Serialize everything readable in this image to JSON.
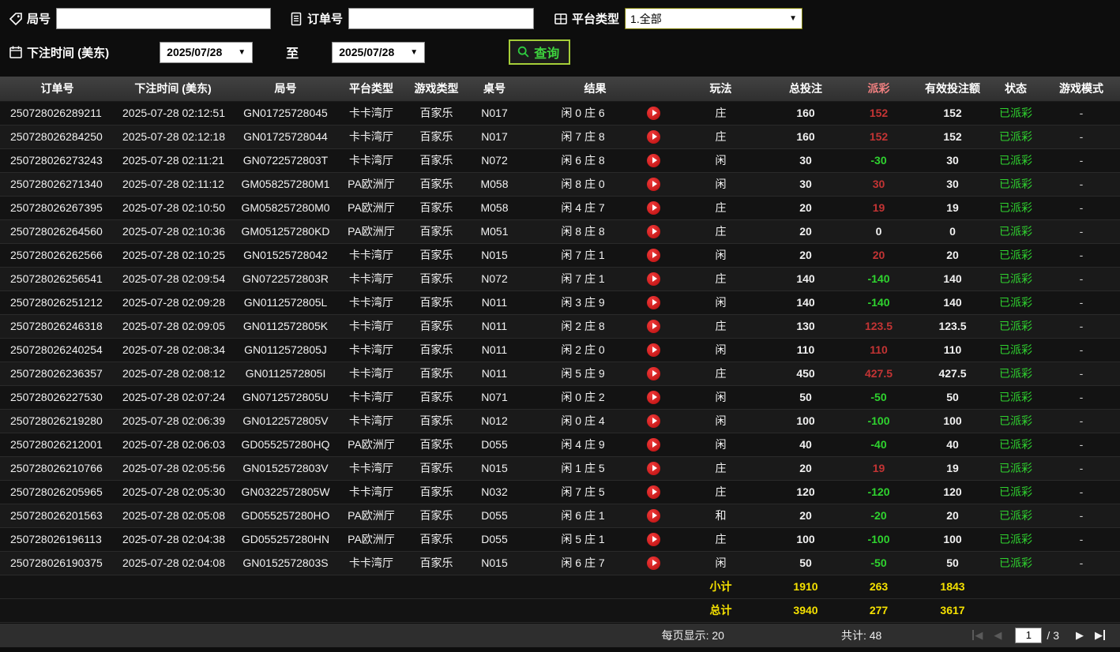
{
  "filters": {
    "round": {
      "label": "局号",
      "value": "",
      "icon": "tag-icon"
    },
    "order": {
      "label": "订单号",
      "value": "",
      "icon": "document-icon"
    },
    "platform": {
      "label": "平台类型",
      "value": "1.全部",
      "icon": "platform-grid-icon"
    },
    "bet_time": {
      "label": "下注时间 (美东)",
      "icon": "calendar-icon"
    },
    "date_from": "2025/07/28",
    "date_to": "2025/07/28",
    "to_label": "至",
    "query_button": "查询",
    "query_icon": "search-icon"
  },
  "table": {
    "headers": [
      "订单号",
      "下注时间 (美东)",
      "局号",
      "平台类型",
      "游戏类型",
      "桌号",
      "结果",
      "玩法",
      "总投注",
      "派彩",
      "有效投注额",
      "状态",
      "游戏模式"
    ],
    "result_icon": "play-icon",
    "rows": [
      {
        "order": "250728026289211",
        "time": "2025-07-28 02:12:51",
        "round": "GN01725728045",
        "platform": "卡卡湾厅",
        "game": "百家乐",
        "table_no": "N017",
        "result": "闲 0 庄 6",
        "play": "庄",
        "bet": "160",
        "payout": "152",
        "valid": "152",
        "status": "已派彩",
        "mode": "-"
      },
      {
        "order": "250728026284250",
        "time": "2025-07-28 02:12:18",
        "round": "GN01725728044",
        "platform": "卡卡湾厅",
        "game": "百家乐",
        "table_no": "N017",
        "result": "闲 7 庄 8",
        "play": "庄",
        "bet": "160",
        "payout": "152",
        "valid": "152",
        "status": "已派彩",
        "mode": "-"
      },
      {
        "order": "250728026273243",
        "time": "2025-07-28 02:11:21",
        "round": "GN0722572803T",
        "platform": "卡卡湾厅",
        "game": "百家乐",
        "table_no": "N072",
        "result": "闲 6 庄 8",
        "play": "闲",
        "bet": "30",
        "payout": "-30",
        "valid": "30",
        "status": "已派彩",
        "mode": "-"
      },
      {
        "order": "250728026271340",
        "time": "2025-07-28 02:11:12",
        "round": "GM058257280M1",
        "platform": "PA欧洲厅",
        "game": "百家乐",
        "table_no": "M058",
        "result": "闲 8 庄 0",
        "play": "闲",
        "bet": "30",
        "payout": "30",
        "valid": "30",
        "status": "已派彩",
        "mode": "-"
      },
      {
        "order": "250728026267395",
        "time": "2025-07-28 02:10:50",
        "round": "GM058257280M0",
        "platform": "PA欧洲厅",
        "game": "百家乐",
        "table_no": "M058",
        "result": "闲 4 庄 7",
        "play": "庄",
        "bet": "20",
        "payout": "19",
        "valid": "19",
        "status": "已派彩",
        "mode": "-"
      },
      {
        "order": "250728026264560",
        "time": "2025-07-28 02:10:36",
        "round": "GM051257280KD",
        "platform": "PA欧洲厅",
        "game": "百家乐",
        "table_no": "M051",
        "result": "闲 8 庄 8",
        "play": "庄",
        "bet": "20",
        "payout": "0",
        "valid": "0",
        "status": "已派彩",
        "mode": "-"
      },
      {
        "order": "250728026262566",
        "time": "2025-07-28 02:10:25",
        "round": "GN01525728042",
        "platform": "卡卡湾厅",
        "game": "百家乐",
        "table_no": "N015",
        "result": "闲 7 庄 1",
        "play": "闲",
        "bet": "20",
        "payout": "20",
        "valid": "20",
        "status": "已派彩",
        "mode": "-"
      },
      {
        "order": "250728026256541",
        "time": "2025-07-28 02:09:54",
        "round": "GN0722572803R",
        "platform": "卡卡湾厅",
        "game": "百家乐",
        "table_no": "N072",
        "result": "闲 7 庄 1",
        "play": "庄",
        "bet": "140",
        "payout": "-140",
        "valid": "140",
        "status": "已派彩",
        "mode": "-"
      },
      {
        "order": "250728026251212",
        "time": "2025-07-28 02:09:28",
        "round": "GN0112572805L",
        "platform": "卡卡湾厅",
        "game": "百家乐",
        "table_no": "N011",
        "result": "闲 3 庄 9",
        "play": "闲",
        "bet": "140",
        "payout": "-140",
        "valid": "140",
        "status": "已派彩",
        "mode": "-"
      },
      {
        "order": "250728026246318",
        "time": "2025-07-28 02:09:05",
        "round": "GN0112572805K",
        "platform": "卡卡湾厅",
        "game": "百家乐",
        "table_no": "N011",
        "result": "闲 2 庄 8",
        "play": "庄",
        "bet": "130",
        "payout": "123.5",
        "valid": "123.5",
        "status": "已派彩",
        "mode": "-"
      },
      {
        "order": "250728026240254",
        "time": "2025-07-28 02:08:34",
        "round": "GN0112572805J",
        "platform": "卡卡湾厅",
        "game": "百家乐",
        "table_no": "N011",
        "result": "闲 2 庄 0",
        "play": "闲",
        "bet": "110",
        "payout": "110",
        "valid": "110",
        "status": "已派彩",
        "mode": "-"
      },
      {
        "order": "250728026236357",
        "time": "2025-07-28 02:08:12",
        "round": "GN0112572805I",
        "platform": "卡卡湾厅",
        "game": "百家乐",
        "table_no": "N011",
        "result": "闲 5 庄 9",
        "play": "庄",
        "bet": "450",
        "payout": "427.5",
        "valid": "427.5",
        "status": "已派彩",
        "mode": "-"
      },
      {
        "order": "250728026227530",
        "time": "2025-07-28 02:07:24",
        "round": "GN0712572805U",
        "platform": "卡卡湾厅",
        "game": "百家乐",
        "table_no": "N071",
        "result": "闲 0 庄 2",
        "play": "闲",
        "bet": "50",
        "payout": "-50",
        "valid": "50",
        "status": "已派彩",
        "mode": "-"
      },
      {
        "order": "250728026219280",
        "time": "2025-07-28 02:06:39",
        "round": "GN0122572805V",
        "platform": "卡卡湾厅",
        "game": "百家乐",
        "table_no": "N012",
        "result": "闲 0 庄 4",
        "play": "闲",
        "bet": "100",
        "payout": "-100",
        "valid": "100",
        "status": "已派彩",
        "mode": "-"
      },
      {
        "order": "250728026212001",
        "time": "2025-07-28 02:06:03",
        "round": "GD055257280HQ",
        "platform": "PA欧洲厅",
        "game": "百家乐",
        "table_no": "D055",
        "result": "闲 4 庄 9",
        "play": "闲",
        "bet": "40",
        "payout": "-40",
        "valid": "40",
        "status": "已派彩",
        "mode": "-"
      },
      {
        "order": "250728026210766",
        "time": "2025-07-28 02:05:56",
        "round": "GN0152572803V",
        "platform": "卡卡湾厅",
        "game": "百家乐",
        "table_no": "N015",
        "result": "闲 1 庄 5",
        "play": "庄",
        "bet": "20",
        "payout": "19",
        "valid": "19",
        "status": "已派彩",
        "mode": "-"
      },
      {
        "order": "250728026205965",
        "time": "2025-07-28 02:05:30",
        "round": "GN0322572805W",
        "platform": "卡卡湾厅",
        "game": "百家乐",
        "table_no": "N032",
        "result": "闲 7 庄 5",
        "play": "庄",
        "bet": "120",
        "payout": "-120",
        "valid": "120",
        "status": "已派彩",
        "mode": "-"
      },
      {
        "order": "250728026201563",
        "time": "2025-07-28 02:05:08",
        "round": "GD055257280HO",
        "platform": "PA欧洲厅",
        "game": "百家乐",
        "table_no": "D055",
        "result": "闲 6 庄 1",
        "play": "和",
        "bet": "20",
        "payout": "-20",
        "valid": "20",
        "status": "已派彩",
        "mode": "-"
      },
      {
        "order": "250728026196113",
        "time": "2025-07-28 02:04:38",
        "round": "GD055257280HN",
        "platform": "PA欧洲厅",
        "game": "百家乐",
        "table_no": "D055",
        "result": "闲 5 庄 1",
        "play": "庄",
        "bet": "100",
        "payout": "-100",
        "valid": "100",
        "status": "已派彩",
        "mode": "-"
      },
      {
        "order": "250728026190375",
        "time": "2025-07-28 02:04:08",
        "round": "GN0152572803S",
        "platform": "卡卡湾厅",
        "game": "百家乐",
        "table_no": "N015",
        "result": "闲 6 庄 7",
        "play": "闲",
        "bet": "50",
        "payout": "-50",
        "valid": "50",
        "status": "已派彩",
        "mode": "-"
      }
    ]
  },
  "summary": {
    "subtotal": {
      "label": "小计",
      "total_bet": "1910",
      "payout": "263",
      "valid_bet": "1843"
    },
    "total": {
      "label": "总计",
      "total_bet": "3940",
      "payout": "277",
      "valid_bet": "3617"
    }
  },
  "pagination": {
    "per_page_label": "每页显示:",
    "per_page_value": "20",
    "total_label": "共计:",
    "total_value": "48",
    "current_page": "1",
    "separator": "/",
    "total_pages": "3",
    "icons": [
      "first-page-icon",
      "prev-page-icon",
      "next-page-icon",
      "last-page-icon"
    ]
  },
  "colors": {
    "payout_positive": "#c33434",
    "payout_negative": "#2fd32f",
    "status_green": "#2fd32f",
    "summary_yellow": "#f5e100",
    "query_accent": "#a6ce39",
    "result_play_red": "#c11414"
  }
}
